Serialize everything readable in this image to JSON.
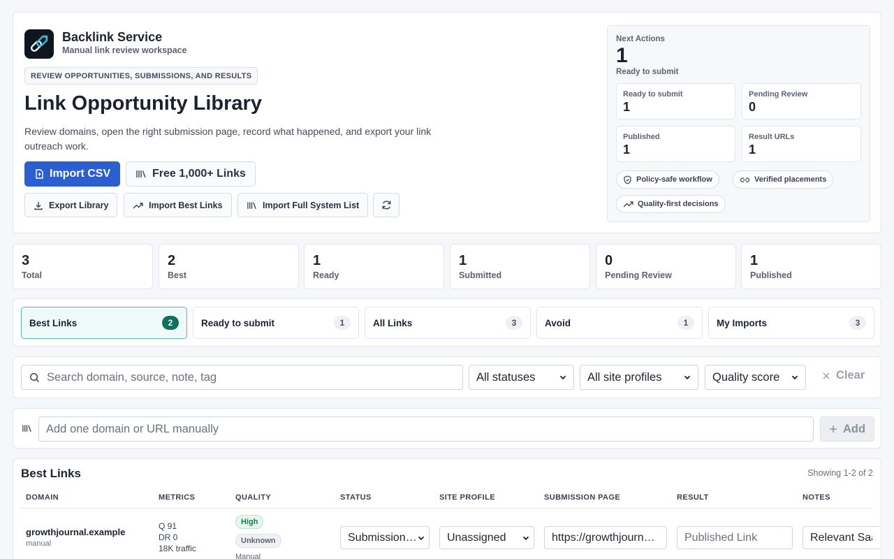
{
  "brand": {
    "name": "Backlink Service",
    "subtitle": "Manual link review workspace"
  },
  "hero": {
    "eyebrow": "REVIEW OPPORTUNITIES, SUBMISSIONS, AND RESULTS",
    "title": "Link Opportunity Library",
    "description": "Review domains, open the right submission page, record what happened, and export your link outreach work.",
    "buttons": {
      "import_csv": "Import CSV",
      "free_links": "Free 1,000+ Links",
      "export_library": "Export Library",
      "import_best": "Import Best Links",
      "import_full": "Import Full System List"
    }
  },
  "next_actions": {
    "label": "Next Actions",
    "value": "1",
    "subtitle": "Ready to submit",
    "stats": [
      {
        "label": "Ready to submit",
        "value": "1"
      },
      {
        "label": "Pending Review",
        "value": "0"
      },
      {
        "label": "Published",
        "value": "1"
      },
      {
        "label": "Result URLs",
        "value": "1"
      }
    ],
    "pills": [
      "Policy-safe workflow",
      "Verified placements",
      "Quality-first decisions"
    ]
  },
  "stats": [
    {
      "value": "3",
      "label": "Total"
    },
    {
      "value": "2",
      "label": "Best"
    },
    {
      "value": "1",
      "label": "Ready"
    },
    {
      "value": "1",
      "label": "Submitted"
    },
    {
      "value": "0",
      "label": "Pending Review"
    },
    {
      "value": "1",
      "label": "Published"
    }
  ],
  "tabs": [
    {
      "label": "Best Links",
      "count": "2",
      "active": true
    },
    {
      "label": "Ready to submit",
      "count": "1"
    },
    {
      "label": "All Links",
      "count": "3"
    },
    {
      "label": "Avoid",
      "count": "1"
    },
    {
      "label": "My Imports",
      "count": "3"
    }
  ],
  "filters": {
    "search_placeholder": "Search domain, source, note, tag",
    "status": "All statuses",
    "profile": "All site profiles",
    "sort": "Quality score",
    "clear": "Clear"
  },
  "add": {
    "placeholder": "Add one domain or URL manually",
    "button": "Add"
  },
  "table": {
    "title": "Best Links",
    "count": "Showing 1-2 of 2",
    "headers": [
      "DOMAIN",
      "METRICS",
      "QUALITY",
      "STATUS",
      "SITE PROFILE",
      "SUBMISSION PAGE",
      "RESULT",
      "NOTES"
    ],
    "rows": [
      {
        "domain": "growthjournal.example",
        "source": "manual",
        "metrics": [
          "Q 91",
          "DR 0",
          "18K traffic"
        ],
        "quality": [
          "High",
          "Unknown"
        ],
        "quality_sub": "Manual",
        "status": "Submission page",
        "profile": "Unassigned",
        "submission": "https://growthjournal.example",
        "result_placeholder": "Published Link",
        "notes": "Relevant SaaS"
      }
    ]
  },
  "colors": {
    "primary": "#2b5fd0",
    "active_tab": "#136d60"
  }
}
